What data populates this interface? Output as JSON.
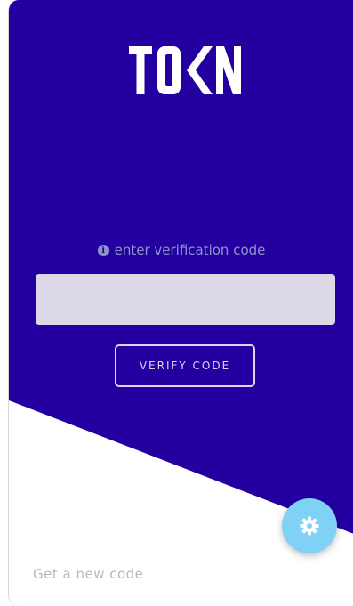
{
  "brand": {
    "logo_text": "TOKN",
    "primary_color": "#2400a0",
    "accent_color": "#7fd2f6"
  },
  "verification": {
    "hint_icon": "info-circle-icon",
    "hint_text": "enter verification code",
    "code_value": "",
    "code_placeholder": "",
    "verify_label": "VERIFY CODE"
  },
  "footer": {
    "new_code_label": "Get a new code"
  },
  "settings": {
    "icon": "gear-icon"
  }
}
